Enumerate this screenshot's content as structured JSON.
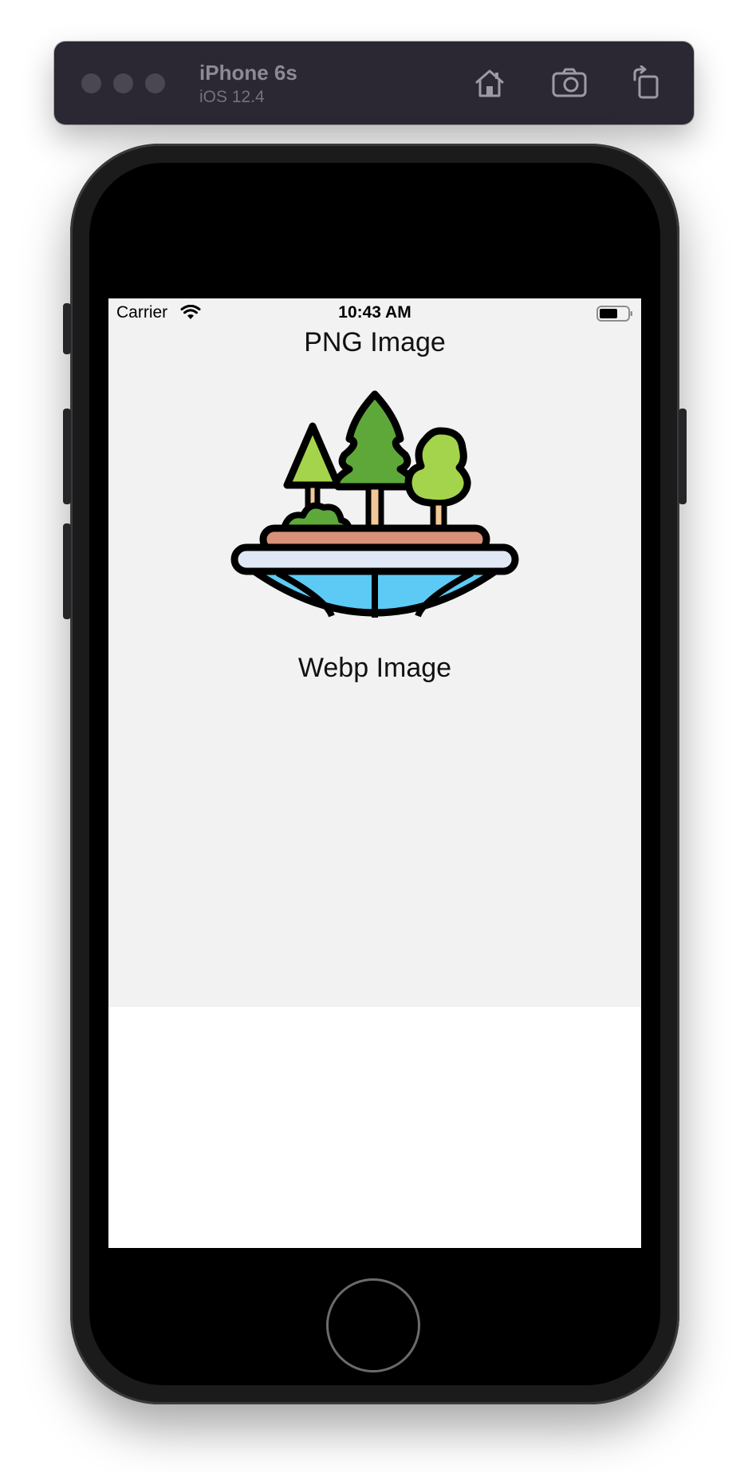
{
  "simulator": {
    "device_name": "iPhone 6s",
    "os_version": "iOS 12.4",
    "toolbar_icons": [
      "home-icon",
      "screenshot-icon",
      "rotate-icon"
    ]
  },
  "status_bar": {
    "carrier": "Carrier",
    "time": "10:43 AM"
  },
  "app": {
    "png_label": "PNG Image",
    "webp_label": "Webp Image"
  },
  "colors": {
    "toolbar_bg": "#2b2833",
    "app_bg": "#f2f2f2",
    "tree_dark": "#5ea83a",
    "tree_light": "#a4d44c",
    "trunk": "#f3c899",
    "soil": "#d9917a",
    "rim": "#dfe8f4",
    "water": "#5ccaf5"
  }
}
